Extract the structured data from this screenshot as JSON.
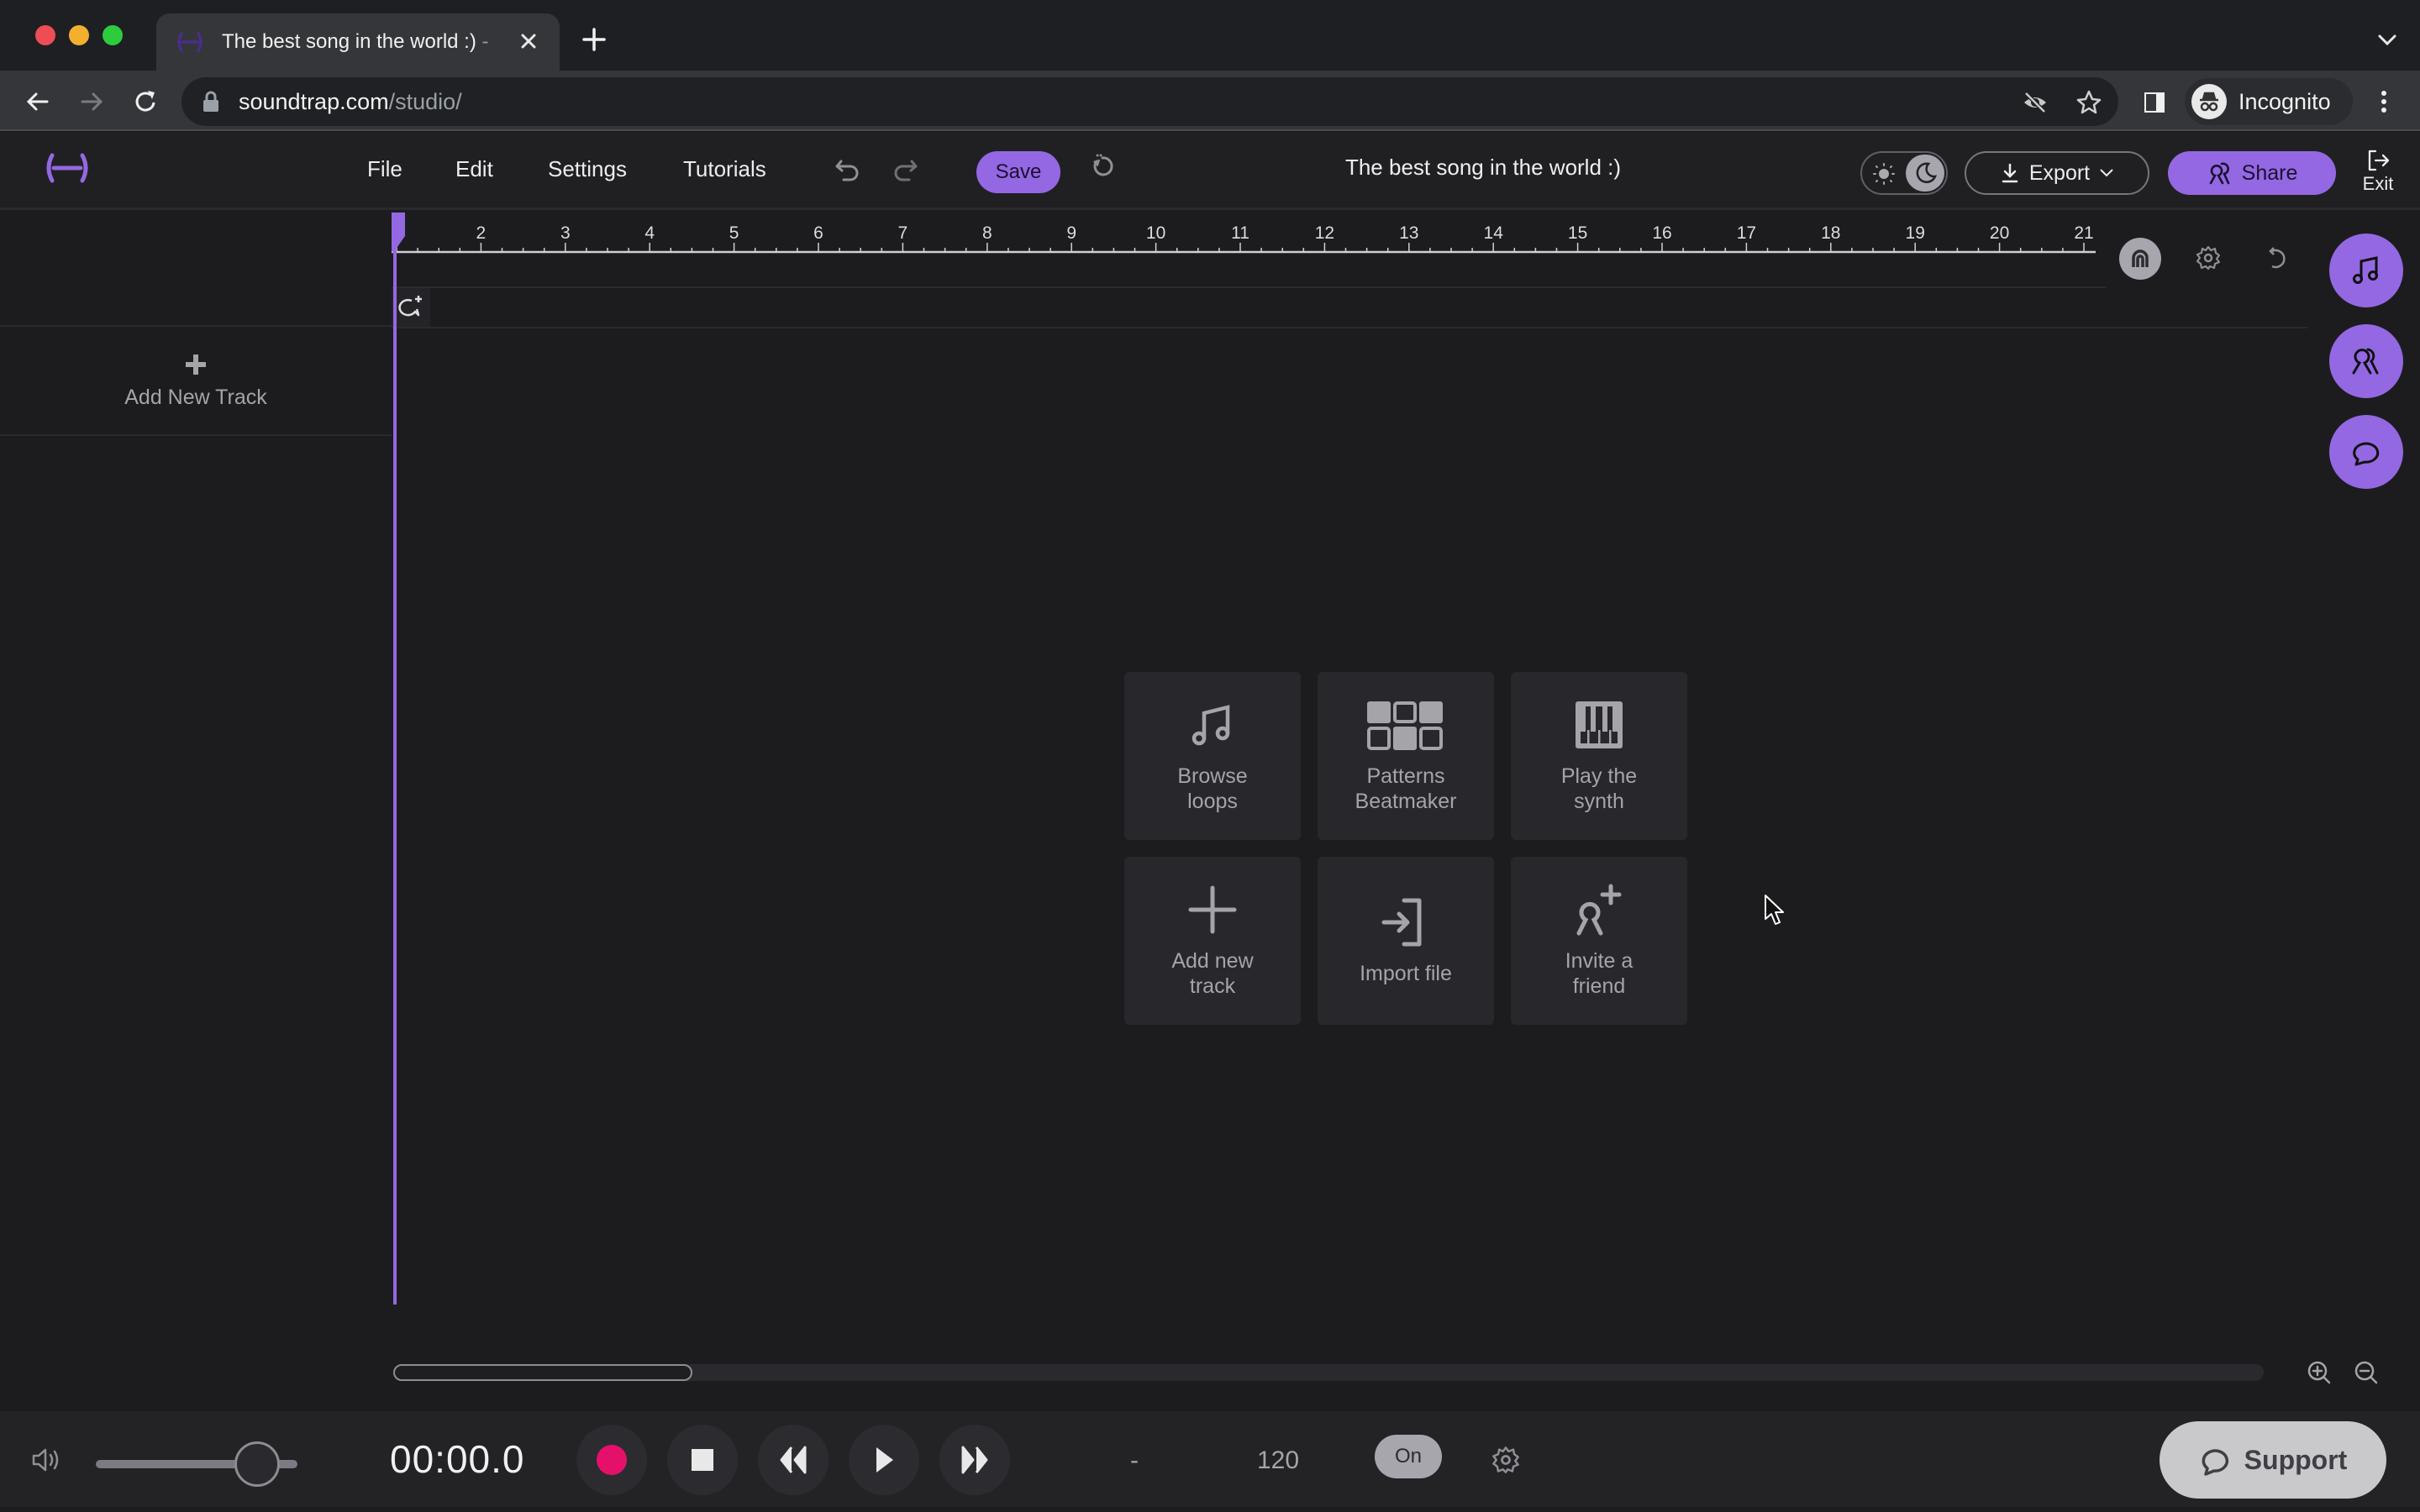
{
  "browser": {
    "tab": {
      "title": "The best song in the world :)",
      "favicon": "soundtrap-logo-icon",
      "close_icon": "close-icon"
    },
    "new_tab_icon": "plus-icon",
    "tab_list_icon": "chevron-down-icon",
    "nav": {
      "back_icon": "arrow-left-icon",
      "forward_icon": "arrow-right-icon",
      "reload_icon": "reload-icon"
    },
    "address": {
      "host": "soundtrap.com",
      "path": "/studio/",
      "lock_icon": "lock-icon"
    },
    "omnibox_icons": [
      "eye-off-icon",
      "star-icon"
    ],
    "side_panel_icon": "side-panel-icon",
    "profile": {
      "label": "Incognito",
      "icon": "incognito-icon"
    },
    "menu_icon": "kebab-menu-icon"
  },
  "header": {
    "logo": "soundtrap-logo-icon",
    "menu": [
      "File",
      "Edit",
      "Settings",
      "Tutorials"
    ],
    "undo_icon": "undo-icon",
    "redo_icon": "redo-icon",
    "save_label": "Save",
    "history_icon": "history-icon",
    "project_title": "The best song in the world :)",
    "theme": {
      "light_icon": "sun-icon",
      "dark_icon": "moon-icon",
      "active": "dark"
    },
    "export_label": "Export",
    "share_label": "Share",
    "exit_label": "Exit"
  },
  "tracks": {
    "add_track_label": "Add New Track"
  },
  "timeline": {
    "ruler_labels": [
      "2",
      "3",
      "4",
      "5",
      "6",
      "7",
      "8",
      "9",
      "10",
      "11",
      "12",
      "13",
      "14",
      "15",
      "16",
      "17",
      "18",
      "19",
      "20",
      "21"
    ],
    "ruler_start_bar": 1,
    "ruler_end_bar": 21,
    "playhead_bar": 1,
    "tools": [
      "magnet-snap-icon",
      "gear-icon",
      "loop-icon"
    ],
    "comment_add_icon": "comment-add-icon",
    "scroll_thumb_fraction": 0.16
  },
  "side_fabs": [
    {
      "name": "loops-fab",
      "icon": "music-note-icon"
    },
    {
      "name": "collaborators-fab",
      "icon": "people-icon"
    },
    {
      "name": "chat-fab",
      "icon": "chat-icon"
    }
  ],
  "start_actions": [
    {
      "label": "Browse\nloops",
      "icon": "music-note-icon"
    },
    {
      "label": "Patterns\nBeatmaker",
      "icon": "beat-pads-icon"
    },
    {
      "label": "Play the\nsynth",
      "icon": "piano-keys-icon"
    },
    {
      "label": "Add new\ntrack",
      "icon": "plus-icon"
    },
    {
      "label": "Import file",
      "icon": "import-icon"
    },
    {
      "label": "Invite a\nfriend",
      "icon": "add-person-icon"
    }
  ],
  "zoom_controls": {
    "zoom_in_icon": "zoom-in-icon",
    "zoom_out_icon": "zoom-out-icon"
  },
  "transport": {
    "volume_icon": "speaker-icon",
    "volume_level": 0.8,
    "time": "00:00.0",
    "buttons": [
      "record",
      "stop",
      "rewind",
      "play",
      "fast-forward"
    ],
    "record_color": "#e5106a",
    "key": "-",
    "tempo": "120",
    "metronome_label": "On",
    "settings_icon": "gear-icon",
    "support_label": "Support"
  },
  "colors": {
    "accent": "#9468e2",
    "background": "#1c1c1f",
    "record": "#e5106a"
  }
}
